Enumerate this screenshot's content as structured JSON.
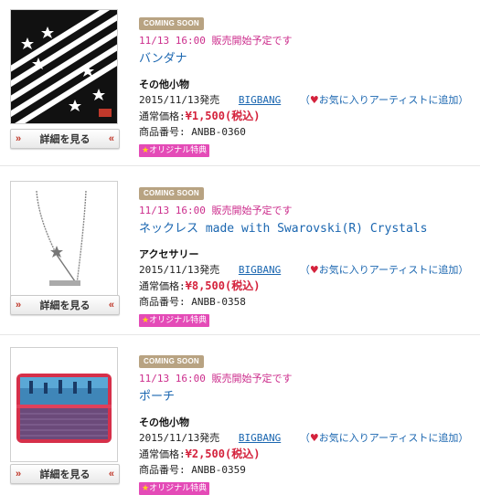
{
  "detail_button_label": "詳細を見る",
  "detail_arrow": "»",
  "detail_arrow_right": "«",
  "coming_soon_label": "COMING SOON",
  "price_label": "通常価格:",
  "product_no_label": "商品番号:",
  "favorite_link": "お気に入りアーティストに追加",
  "original_badge": "オリジナル特典",
  "products": [
    {
      "release_note": "11/13 16:00 販売開始予定です",
      "name": "バンダナ",
      "category": "その他小物",
      "release_date": "2015/11/13発売",
      "artist": "BIGBANG",
      "price": "¥1,500(税込)",
      "product_no": "ANBB-0360",
      "image": "bandana"
    },
    {
      "release_note": "11/13 16:00 販売開始予定です",
      "name": "ネックレス made with Swarovski(R) Crystals",
      "category": "アクセサリー",
      "release_date": "2015/11/13発売",
      "artist": "BIGBANG",
      "price": "¥8,500(税込)",
      "product_no": "ANBB-0358",
      "image": "necklace"
    },
    {
      "release_note": "11/13 16:00 販売開始予定です",
      "name": "ポーチ",
      "category": "その他小物",
      "release_date": "2015/11/13発売",
      "artist": "BIGBANG",
      "price": "¥2,500(税込)",
      "product_no": "ANBB-0359",
      "image": "pouch"
    }
  ],
  "colors": {
    "accent_pink": "#cc2d8c",
    "link_blue": "#1a66b0",
    "price_red": "#d4223c",
    "badge_magenta": "#e44bb7",
    "coming_soon_tan": "#b8a382"
  }
}
